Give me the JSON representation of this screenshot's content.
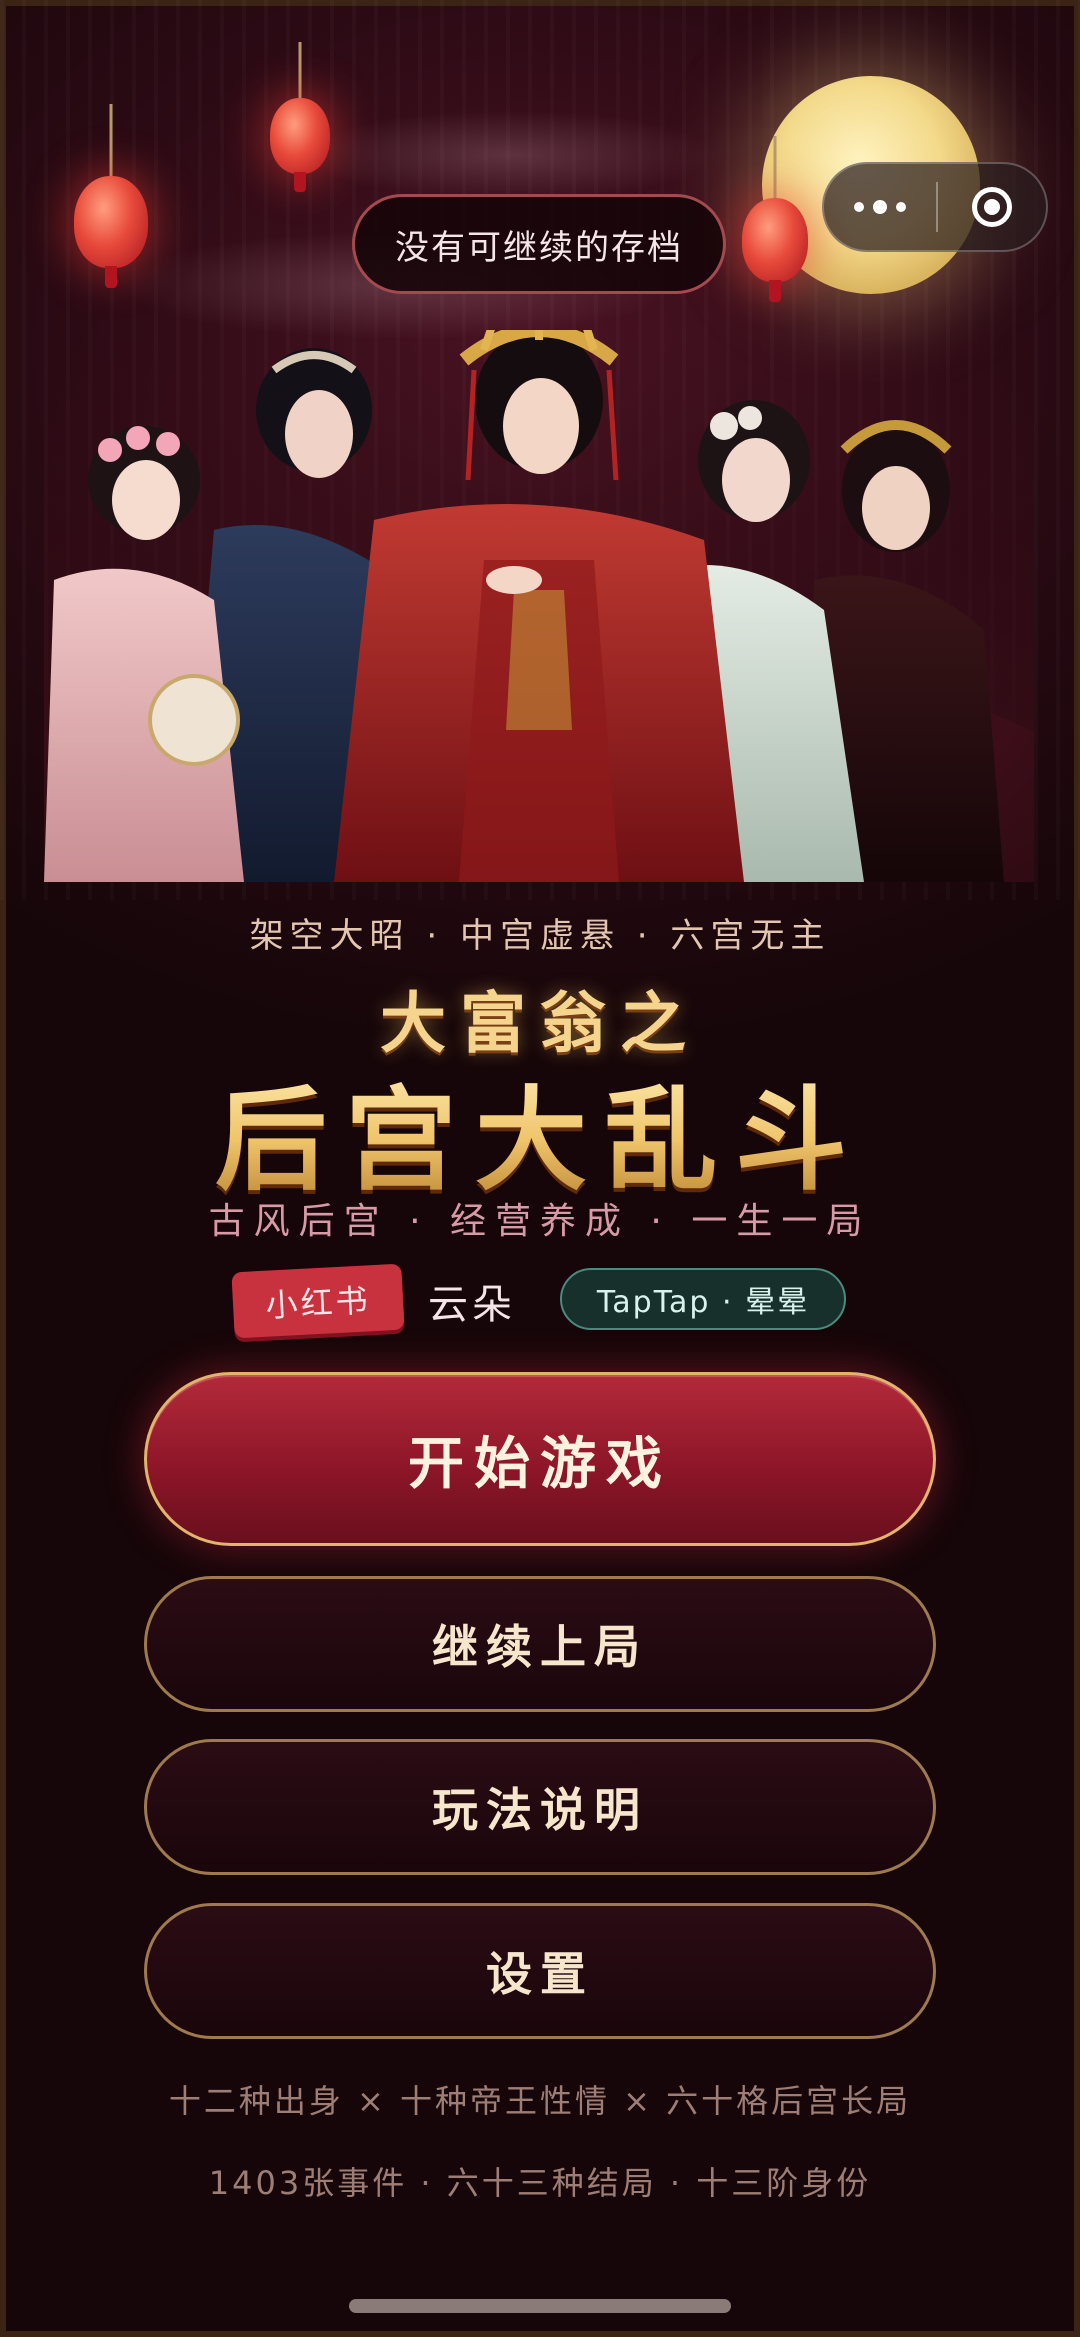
{
  "toast": {
    "text": "没有可继续的存档"
  },
  "mini_program_capsule": {
    "more_icon": "ellipsis-icon",
    "close_icon": "target-close-icon"
  },
  "banner": {
    "image": "five-palace-ladies-illustration"
  },
  "header": {
    "subtitle": "架空大昭 · 中宫虚悬 · 六宫无主",
    "title_line1": "大富翁之",
    "title_line2": "后宫大乱斗",
    "tagline": "古风后宫 · 经营养成 · 一生一局"
  },
  "badges": {
    "xiaohongshu": "小红书",
    "author": "云朵",
    "taptap": "TapTap · 晕晕"
  },
  "menu": {
    "start": "开始游戏",
    "continue": "继续上局",
    "howto": "玩法说明",
    "settings": "设置"
  },
  "footer": {
    "line1": "十二种出身 × 十种帝王性情 × 六十格后宫长局",
    "line2": "1403张事件 · 六十三种结局 · 十三阶身份"
  },
  "colors": {
    "accent_red": "#8d1628",
    "gold": "#e2b56b",
    "background": "#160609"
  }
}
